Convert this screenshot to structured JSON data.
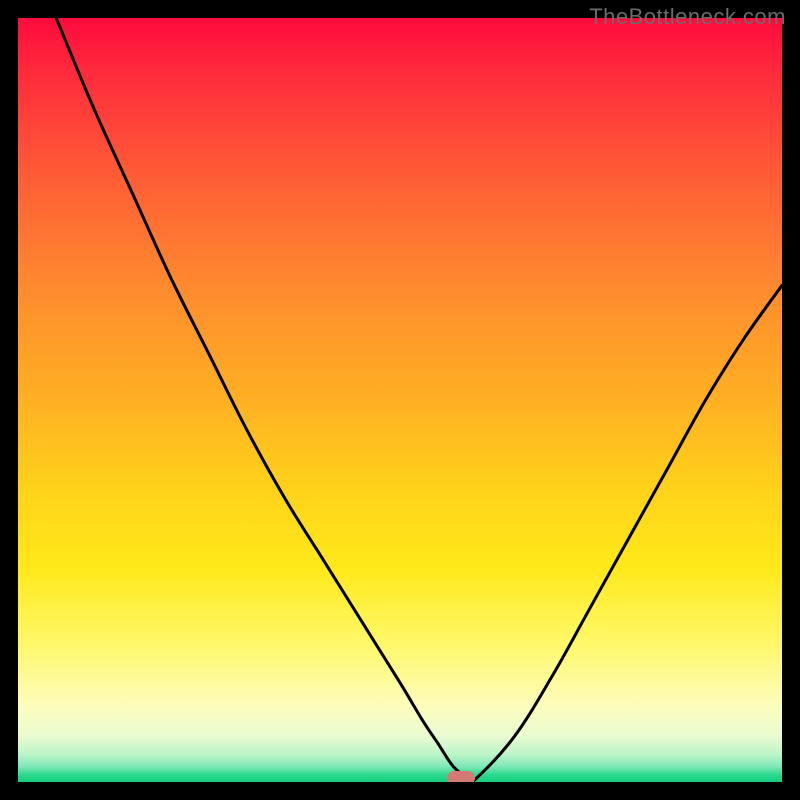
{
  "watermark": "TheBottleneck.com",
  "chart_data": {
    "type": "line",
    "title": "",
    "xlabel": "",
    "ylabel": "",
    "xlim": [
      0,
      100
    ],
    "ylim": [
      0,
      100
    ],
    "grid": false,
    "legend": false,
    "series": [
      {
        "name": "bottleneck-curve",
        "x": [
          5,
          10,
          15,
          20,
          25,
          30,
          35,
          40,
          45,
          50,
          53,
          55,
          57,
          59,
          60,
          65,
          70,
          75,
          80,
          85,
          90,
          95,
          100
        ],
        "y": [
          100,
          88,
          77,
          66,
          56,
          46,
          37,
          29,
          21,
          13,
          8,
          5,
          2,
          0.5,
          0.5,
          6,
          14,
          23,
          32,
          41,
          50,
          58,
          65
        ]
      }
    ],
    "annotations": [
      {
        "name": "optimal-marker",
        "x": 58,
        "y": 0.5
      }
    ],
    "background": {
      "type": "rainbow-severity-gradient",
      "top_color": "#ff0b3c",
      "bottom_color": "#14cf7e"
    }
  }
}
